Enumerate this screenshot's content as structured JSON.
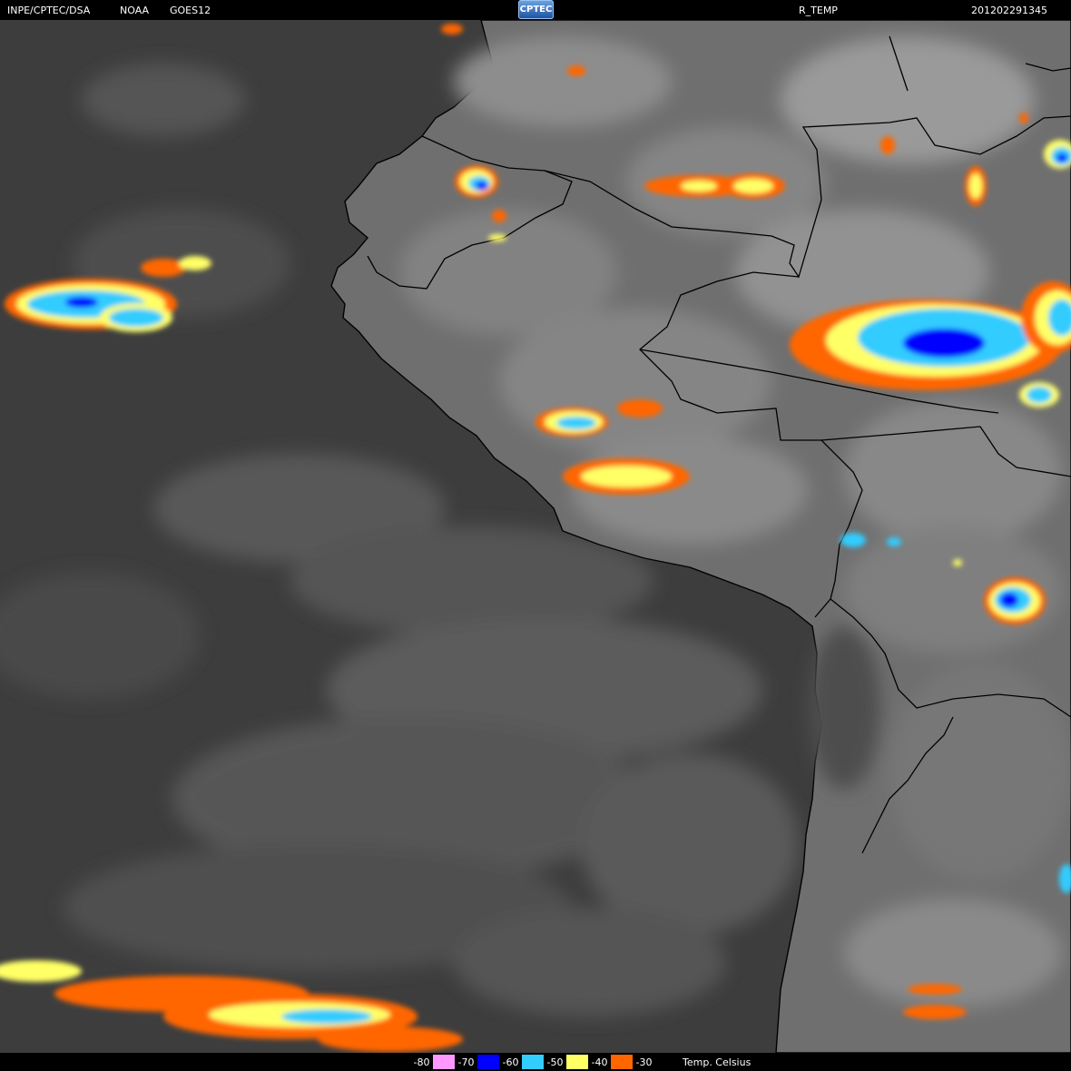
{
  "header": {
    "source": "INPE/CPTEC/DSA",
    "agency": "NOAA",
    "satellite": "GOES12",
    "logo_text": "CPTEC",
    "product": "R_TEMP",
    "timestamp": "201202291345"
  },
  "legend": {
    "items": [
      {
        "label": "-80",
        "color": "#ff99ff"
      },
      {
        "label": "-70",
        "color": "#0000ff"
      },
      {
        "label": "-60",
        "color": "#33ccff"
      },
      {
        "label": "-50",
        "color": "#ffff66"
      },
      {
        "label": "-40",
        "color": "#ff6600"
      },
      {
        "label": "-30",
        "color": "#000000"
      }
    ],
    "unit": "Temp. Celsius"
  },
  "colors": {
    "background_ocean": "#3d3d3d",
    "land": "#7a7a7a",
    "coastline": "#000000",
    "cloud": "#b8b8b8"
  }
}
